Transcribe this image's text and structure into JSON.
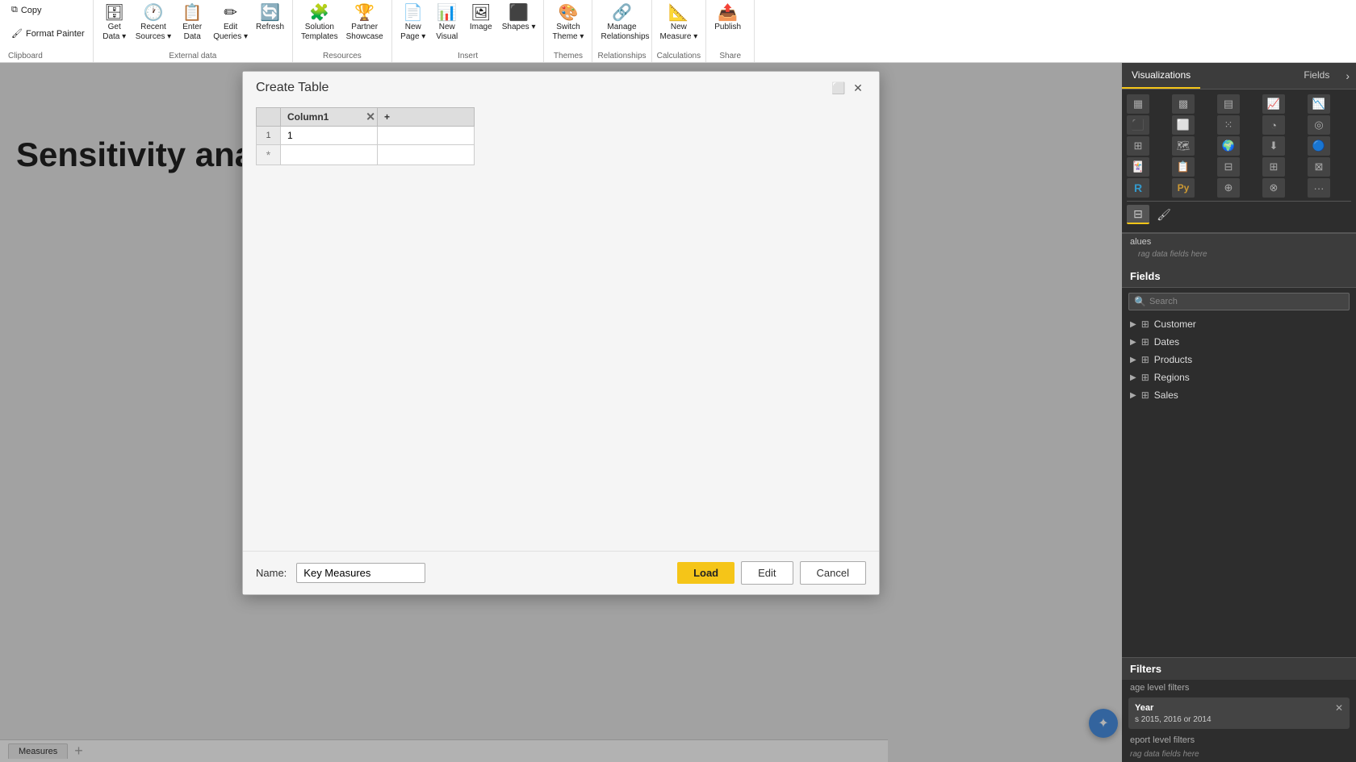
{
  "ribbon": {
    "groups": [
      {
        "name": "clipboard",
        "label": "Clipboard",
        "buttons": [
          {
            "id": "copy",
            "label": "Copy",
            "icon": "⧉"
          },
          {
            "id": "format-painter",
            "label": "Format Painter",
            "icon": "🖌"
          }
        ]
      },
      {
        "name": "external-data",
        "label": "External data",
        "buttons": [
          {
            "id": "get-data",
            "label": "Get Data",
            "icon": "🗄",
            "hasDropdown": true
          },
          {
            "id": "recent-sources",
            "label": "Recent Sources",
            "icon": "🕐",
            "hasDropdown": true
          },
          {
            "id": "enter-data",
            "label": "Enter Data",
            "icon": "📋"
          },
          {
            "id": "edit-queries",
            "label": "Edit Queries",
            "icon": "✏",
            "hasDropdown": true
          },
          {
            "id": "refresh",
            "label": "Refresh",
            "icon": "🔄"
          }
        ]
      },
      {
        "name": "resources",
        "label": "Resources",
        "buttons": [
          {
            "id": "solution-templates",
            "label": "Solution Templates",
            "icon": "🧩"
          },
          {
            "id": "partner-showcase",
            "label": "Partner Showcase",
            "icon": "🏆"
          }
        ]
      },
      {
        "name": "insert",
        "label": "Insert",
        "buttons": [
          {
            "id": "new-page",
            "label": "New Page",
            "icon": "📄",
            "hasDropdown": true
          },
          {
            "id": "new-visual",
            "label": "New Visual",
            "icon": "📊"
          },
          {
            "id": "image",
            "label": "Image",
            "icon": "🖼"
          },
          {
            "id": "shapes",
            "label": "Shapes",
            "icon": "⬛",
            "hasDropdown": true
          }
        ]
      },
      {
        "name": "themes",
        "label": "Themes",
        "buttons": [
          {
            "id": "switch-theme",
            "label": "Switch Theme",
            "icon": "🎨",
            "hasDropdown": true
          }
        ]
      },
      {
        "name": "relationships",
        "label": "Relationships",
        "buttons": [
          {
            "id": "manage-relationships",
            "label": "Manage Relationships",
            "icon": "🔗"
          }
        ]
      },
      {
        "name": "calculations",
        "label": "Calculations",
        "buttons": [
          {
            "id": "new-measure",
            "label": "New Measure",
            "icon": "📐",
            "hasDropdown": true
          }
        ]
      },
      {
        "name": "share",
        "label": "Share",
        "buttons": [
          {
            "id": "publish",
            "label": "Publish",
            "icon": "📤"
          }
        ]
      }
    ]
  },
  "canvas": {
    "page_title": "Sensitivity analysi"
  },
  "dialog": {
    "title": "Create Table",
    "table": {
      "columns": [
        "Column1"
      ],
      "rows": [
        {
          "num": 1,
          "col1": "1"
        }
      ]
    },
    "name_label": "Name:",
    "name_value": "Key Measures",
    "buttons": {
      "load": "Load",
      "edit": "Edit",
      "cancel": "Cancel"
    }
  },
  "visualizations": {
    "panel_title": "Visualizations",
    "icons": [
      "bar",
      "stacked-bar",
      "100-bar",
      "line",
      "area",
      "stacked-area",
      "100-area",
      "scatter",
      "pie",
      "donut",
      "treemap",
      "map",
      "filled-map",
      "funnel",
      "gauge",
      "card",
      "kpi",
      "slicer",
      "table-viz",
      "matrix",
      "r-visual",
      "python",
      "custom1",
      "custom2",
      "more"
    ],
    "bottom_tabs": [
      "values",
      "format"
    ]
  },
  "fields": {
    "panel_title": "Fields",
    "search_placeholder": "Search",
    "items": [
      {
        "name": "Customer",
        "icon": "table"
      },
      {
        "name": "Dates",
        "icon": "table"
      },
      {
        "name": "Products",
        "icon": "table"
      },
      {
        "name": "Regions",
        "icon": "table"
      },
      {
        "name": "Sales",
        "icon": "table"
      }
    ]
  },
  "filters": {
    "title": "Filters",
    "page_level_label": "age level filters",
    "active_filter": {
      "field": "Year",
      "value": "s 2015, 2016 or 2014"
    },
    "report_level_label": "eport level filters",
    "drop_zone": "rag data fields here"
  },
  "values_section": {
    "label": "alues",
    "drop_zone": "rag data fields here"
  },
  "bottom": {
    "pages": [
      {
        "label": "Measures",
        "active": true
      }
    ]
  }
}
